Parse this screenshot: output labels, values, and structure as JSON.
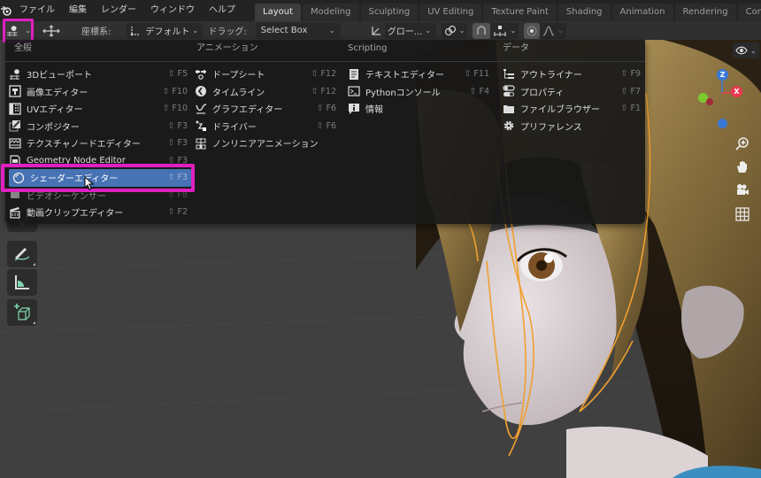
{
  "menubar": {
    "items": [
      "ファイル",
      "編集",
      "レンダー",
      "ウィンドウ",
      "ヘルプ"
    ]
  },
  "workspaces": {
    "tabs": [
      "Layout",
      "Modeling",
      "Sculpting",
      "UV Editing",
      "Texture Paint",
      "Shading",
      "Animation",
      "Rendering",
      "Compositing"
    ],
    "active": "Layout"
  },
  "toolbar": {
    "orientation_label": "座標系:",
    "orientation_value": "デフォルト",
    "drag_label": "ドラッグ:",
    "drag_value": "Select Box",
    "transform_value": "グロー..."
  },
  "editor_menu": {
    "columns": [
      {
        "title": "全般",
        "items": [
          {
            "label": "3Dビューポート",
            "shortcut": "⇧ F5",
            "icon": "viewport-3d-icon"
          },
          {
            "label": "画像エディター",
            "shortcut": "⇧ F10",
            "icon": "image-editor-icon"
          },
          {
            "label": "UVエディター",
            "shortcut": "⇧ F10",
            "icon": "uv-editor-icon"
          },
          {
            "label": "コンポジター",
            "shortcut": "⇧ F3",
            "icon": "compositor-icon"
          },
          {
            "label": "テクスチャノードエディター",
            "shortcut": "⇧ F3",
            "icon": "texture-node-icon"
          },
          {
            "label": "Geometry Node Editor",
            "shortcut": "⇧ F3",
            "icon": "geometry-node-icon"
          },
          {
            "label": "シェーダーエディター",
            "shortcut": "⇧ F3",
            "icon": "shader-editor-icon",
            "highlighted": true
          },
          {
            "label": "ビデオシーケンサー",
            "shortcut": "⇧ F8",
            "icon": "video-sequencer-icon"
          },
          {
            "label": "動画クリップエディター",
            "shortcut": "⇧ F2",
            "icon": "movie-clip-icon"
          }
        ]
      },
      {
        "title": "アニメーション",
        "items": [
          {
            "label": "ドープシート",
            "shortcut": "⇧ F12",
            "icon": "dopesheet-icon"
          },
          {
            "label": "タイムライン",
            "shortcut": "⇧ F12",
            "icon": "timeline-icon"
          },
          {
            "label": "グラフエディター",
            "shortcut": "⇧ F6",
            "icon": "graph-editor-icon"
          },
          {
            "label": "ドライバー",
            "shortcut": "⇧ F6",
            "icon": "drivers-icon"
          },
          {
            "label": "ノンリニアアニメーション",
            "shortcut": "",
            "icon": "nla-icon"
          }
        ]
      },
      {
        "title": "Scripting",
        "items": [
          {
            "label": "テキストエディター",
            "shortcut": "⇧ F11",
            "icon": "text-editor-icon"
          },
          {
            "label": "Pythonコンソール",
            "shortcut": "⇧ F4",
            "icon": "python-console-icon"
          },
          {
            "label": "情報",
            "shortcut": "",
            "icon": "info-icon"
          }
        ]
      },
      {
        "title": "データ",
        "items": [
          {
            "label": "アウトライナー",
            "shortcut": "⇧ F9",
            "icon": "outliner-icon"
          },
          {
            "label": "プロパティ",
            "shortcut": "⇧ F7",
            "icon": "properties-icon"
          },
          {
            "label": "ファイルブラウザー",
            "shortcut": "⇧ F1",
            "icon": "file-browser-icon"
          },
          {
            "label": "プリファレンス",
            "shortcut": "",
            "icon": "preferences-icon"
          }
        ]
      }
    ]
  },
  "gizmo": {
    "x": "X",
    "y": "Y",
    "z": "Z"
  },
  "colors": {
    "accent_highlight": "#4772b3",
    "annotation_magenta": "#e020c0",
    "selection_outline": "#f0a030",
    "axis_x": "#e8394f",
    "axis_y": "#7bc92c",
    "axis_z": "#3a78d8"
  }
}
